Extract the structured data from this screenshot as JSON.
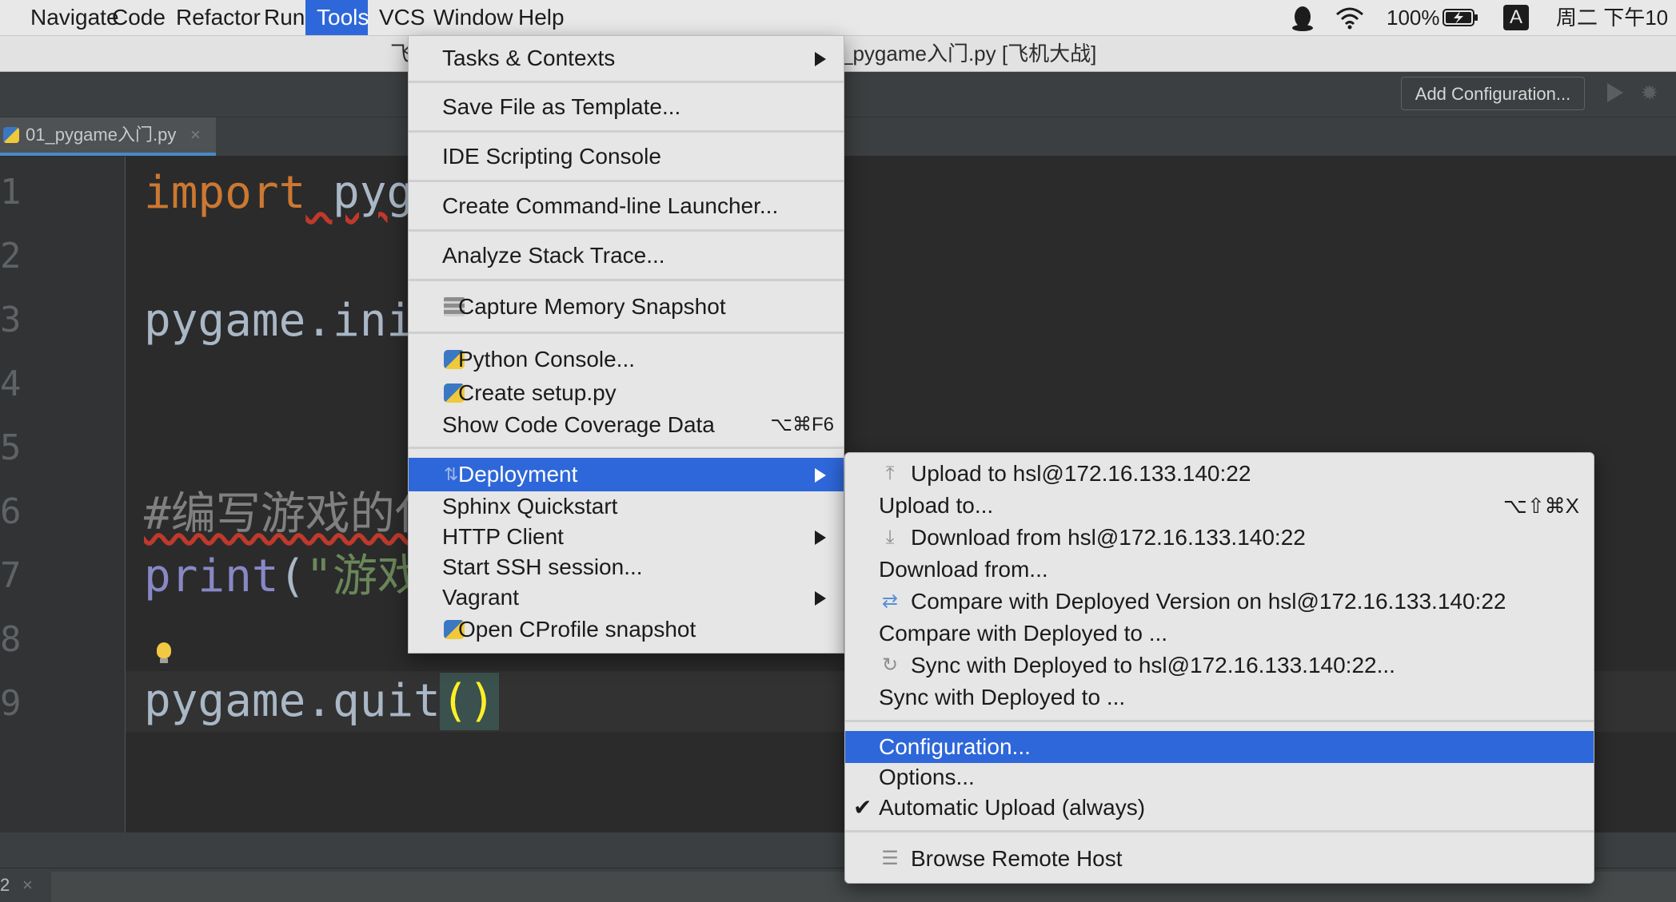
{
  "menubar": {
    "items": [
      "Navigate",
      "Code",
      "Refactor",
      "Run",
      "Tools",
      "VCS",
      "Window",
      "Help"
    ],
    "active": "Tools",
    "battery": "100%",
    "input_method": "A",
    "clock": "周二 下午10"
  },
  "window": {
    "title_left": "飞",
    "title": "_pygame入门.py [飞机大战]"
  },
  "toolbar": {
    "add_configuration": "Add Configuration..."
  },
  "editor": {
    "tab_label": "01_pygame入门.py",
    "tab_close": "×",
    "line_numbers": [
      "1",
      "2",
      "3",
      "4",
      "5",
      "6",
      "7",
      "8",
      "9"
    ],
    "code": {
      "line1_kw": "import",
      "line1_rest": " pyg",
      "line3": "pygame.ini",
      "line6": "#编写游戏的代",
      "line7_fn": "print",
      "line7_paren": "(",
      "line7_str": "\"游戏",
      "line9": "pygame.quit",
      "line9_parens": "()"
    }
  },
  "bottom": {
    "tab_label": "2",
    "tab_close": "×"
  },
  "tools_menu": {
    "tasks_contexts": "Tasks & Contexts",
    "save_template": "Save File as Template...",
    "ide_scripting": "IDE Scripting Console",
    "create_launcher": "Create Command-line Launcher...",
    "analyze_stack": "Analyze Stack Trace...",
    "capture_memory": "Capture Memory Snapshot",
    "python_console": "Python Console...",
    "create_setup": "Create setup.py",
    "show_coverage": "Show Code Coverage Data",
    "show_coverage_shortcut": "⌥⌘F6",
    "deployment": "Deployment",
    "sphinx": "Sphinx Quickstart",
    "http_client": "HTTP Client",
    "ssh_session": "Start SSH session...",
    "vagrant": "Vagrant",
    "cprofile": "Open CProfile snapshot"
  },
  "deployment_menu": {
    "upload_to_host": "Upload to hsl@172.16.133.140:22",
    "upload_to": "Upload to...",
    "upload_to_shortcut": "⌥⇧⌘X",
    "download_from_host": "Download from hsl@172.16.133.140:22",
    "download_from": "Download from...",
    "compare_host": "Compare with Deployed Version on hsl@172.16.133.140:22",
    "compare_to": "Compare with Deployed to ...",
    "sync_host": "Sync with Deployed to hsl@172.16.133.140:22...",
    "sync_to": "Sync with Deployed to ...",
    "configuration": "Configuration...",
    "options": "Options...",
    "auto_upload": "Automatic Upload (always)",
    "browse_remote": "Browse Remote Host"
  },
  "colors": {
    "menu_selection": "#2e67d9",
    "editor_bg": "#2b2b2b",
    "keyword": "#cc7832",
    "string": "#6a8759"
  }
}
